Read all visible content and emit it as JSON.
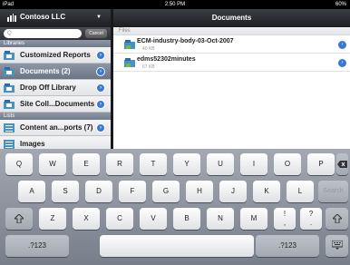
{
  "status": {
    "carrier": "iPad",
    "time": "2:50 PM",
    "battery": "60%"
  },
  "sidebar": {
    "org": "Contoso LLC",
    "search_placeholder": "Q",
    "cancel": "Cancel",
    "libraries_header": "Libraries",
    "libraries": [
      {
        "label": "Customized Reports",
        "selected": false
      },
      {
        "label": "Documents (2)",
        "selected": true
      },
      {
        "label": "Drop Off Library",
        "selected": false
      },
      {
        "label": "Site Coll...Documents",
        "selected": false
      }
    ],
    "lists_header": "Lists",
    "lists": [
      {
        "label": "Content an...ports (7)"
      },
      {
        "label": "Images"
      }
    ]
  },
  "main": {
    "title": "Documents",
    "files_header": "Files",
    "files": [
      {
        "name": "ECM-industry-body-03-Oct-2007",
        "size": "40 KB"
      },
      {
        "name": "edms52302minutes",
        "size": "67 KB"
      }
    ]
  },
  "keyboard": {
    "row1": [
      "Q",
      "W",
      "E",
      "R",
      "T",
      "Y",
      "U",
      "I",
      "O",
      "P"
    ],
    "row2": [
      "A",
      "S",
      "D",
      "F",
      "G",
      "H",
      "J",
      "K",
      "L"
    ],
    "search": "Search",
    "row3": [
      "Z",
      "X",
      "C",
      "V",
      "B",
      "N",
      "M"
    ],
    "exclaim": [
      "!",
      ","
    ],
    "question": [
      "?",
      "."
    ],
    "numbers": ".?123"
  }
}
